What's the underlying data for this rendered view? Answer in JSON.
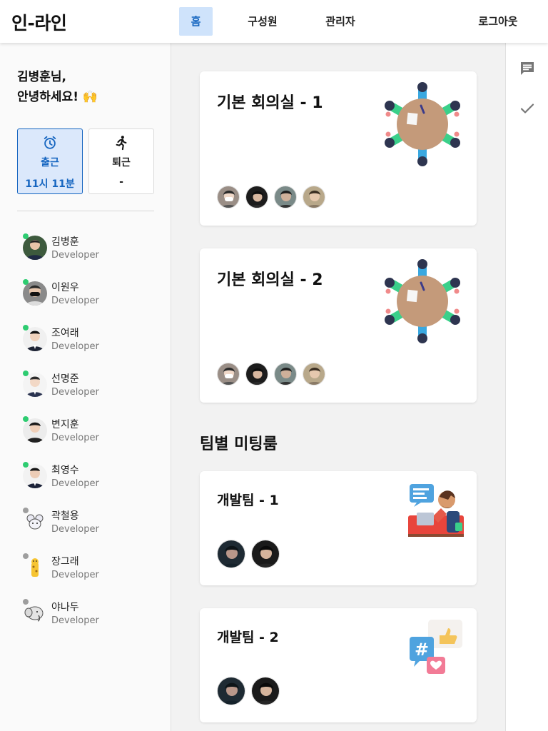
{
  "app": {
    "logo": "인-라인"
  },
  "nav": {
    "home": "홈",
    "members": "구성원",
    "admin": "관리자",
    "logout": "로그아웃"
  },
  "sidebar": {
    "greeting_line1": "김병훈님,",
    "greeting_line2": "안녕하세요! 🙌",
    "check_in": {
      "label": "출근",
      "time": "11시 11분"
    },
    "check_out": {
      "label": "퇴근",
      "time": "-"
    },
    "members": [
      {
        "name": "김병훈",
        "role": "Developer",
        "online": true
      },
      {
        "name": "이원우",
        "role": "Developer",
        "online": true
      },
      {
        "name": "조여래",
        "role": "Developer",
        "online": true
      },
      {
        "name": "선명준",
        "role": "Developer",
        "online": true
      },
      {
        "name": "변지훈",
        "role": "Developer",
        "online": true
      },
      {
        "name": "최영수",
        "role": "Developer",
        "online": true
      },
      {
        "name": "곽철용",
        "role": "Developer",
        "online": false
      },
      {
        "name": "장그래",
        "role": "Developer",
        "online": false
      },
      {
        "name": "야나두",
        "role": "Developer",
        "online": false
      }
    ]
  },
  "rooms": {
    "basic_1": {
      "title": "기본 회의실 - 1",
      "icon": "round-table-illustration"
    },
    "basic_2": {
      "title": "기본 회의실 - 2",
      "icon": "round-table-illustration"
    },
    "team_section_title": "팀별 미팅룸",
    "team_1": {
      "title": "개발팀 - 1",
      "icon": "developer-at-desk-illustration"
    },
    "team_2": {
      "title": "개발팀 - 2",
      "icon": "chat-bubbles-illustration"
    }
  },
  "right_rail": {
    "icons": [
      "chat-icon",
      "check-icon"
    ]
  },
  "colors": {
    "accent": "#1565c0",
    "accent_bg": "#dbe8fb",
    "online": "#2ecc71",
    "offline": "#9e9e9e",
    "main_bg": "#f2f2f2"
  }
}
